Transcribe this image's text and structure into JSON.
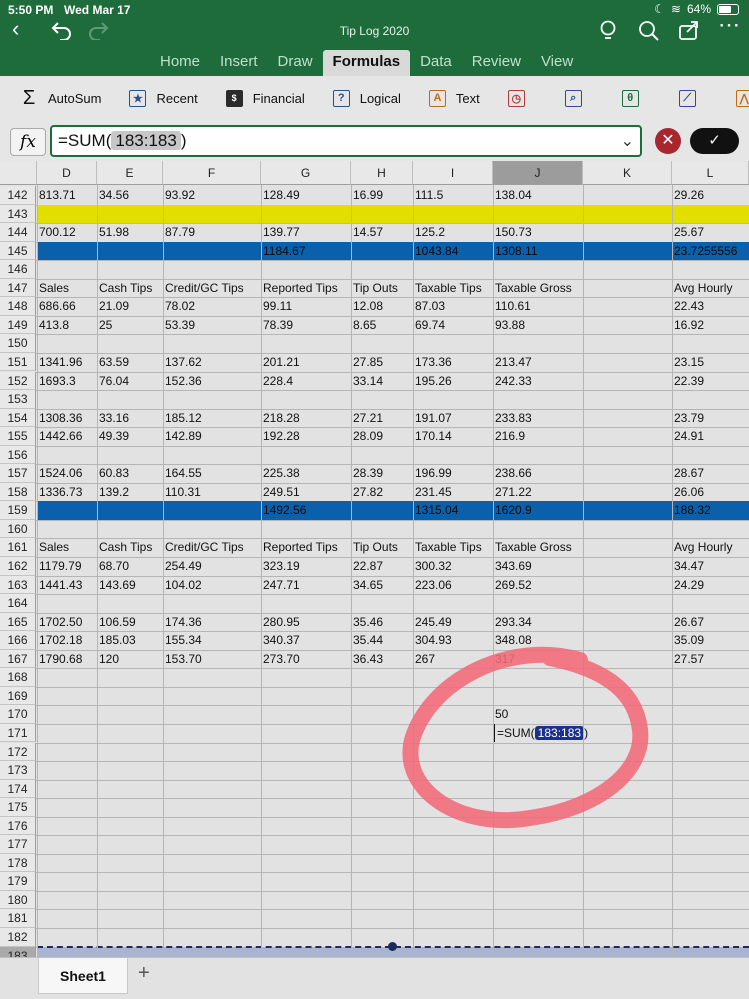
{
  "status": {
    "time": "5:50 PM",
    "date": "Wed Mar 17",
    "battery": "64%"
  },
  "doc_title": "Tip Log 2020",
  "icons": {
    "back": "chevron-left",
    "undo": "undo-arrow",
    "redo": "redo-arrow",
    "idea": "lightbulb",
    "search": "magnifier",
    "share": "share-box",
    "more": "ellipsis"
  },
  "ribbon_tabs": [
    "Home",
    "Insert",
    "Draw",
    "Formulas",
    "Data",
    "Review",
    "View"
  ],
  "active_tab": "Formulas",
  "toolbar": {
    "autosum": "AutoSum",
    "recent": "Recent",
    "financial": "Financial",
    "logical": "Logical",
    "text": "Text"
  },
  "formula_bar": {
    "fx": "fx",
    "prefix": "=SUM(",
    "ref": "183:183",
    "suffix": ")"
  },
  "columns": [
    "D",
    "E",
    "F",
    "G",
    "H",
    "I",
    "J",
    "K",
    "L"
  ],
  "selected_column": "J",
  "rows": [
    {
      "n": "142",
      "cells": [
        "813.71",
        "34.56",
        "93.92",
        "128.49",
        "16.99",
        "111.5",
        "138.04",
        "",
        "29.26"
      ]
    },
    {
      "n": "143",
      "band": "yellow",
      "cells": [
        "",
        "",
        "",
        "",
        "",
        "",
        "",
        "",
        ""
      ]
    },
    {
      "n": "144",
      "cells": [
        "700.12",
        "51.98",
        "87.79",
        "139.77",
        "14.57",
        "125.2",
        "150.73",
        "",
        "25.67"
      ]
    },
    {
      "n": "145",
      "band": "blue",
      "cells": [
        "",
        "",
        "",
        "1184.67",
        "",
        "1043.84",
        "1308.11",
        "",
        "23.7255556"
      ]
    },
    {
      "n": "146",
      "cells": [
        "",
        "",
        "",
        "",
        "",
        "",
        "",
        "",
        ""
      ]
    },
    {
      "n": "147",
      "cells": [
        "Sales",
        "Cash Tips",
        "Credit/GC Tips",
        "Reported Tips",
        "Tip Outs",
        "Taxable Tips",
        "Taxable Gross",
        "",
        "Avg Hourly"
      ]
    },
    {
      "n": "148",
      "cells": [
        "686.66",
        "21.09",
        "78.02",
        "99.11",
        "12.08",
        "87.03",
        "110.61",
        "",
        "22.43"
      ]
    },
    {
      "n": "149",
      "cells": [
        "413.8",
        "25",
        "53.39",
        "78.39",
        "8.65",
        "69.74",
        "93.88",
        "",
        "16.92"
      ]
    },
    {
      "n": "150",
      "cells": [
        "",
        "",
        "",
        "",
        "",
        "",
        "",
        "",
        ""
      ]
    },
    {
      "n": "151",
      "cells": [
        "1341.96",
        "63.59",
        "137.62",
        "201.21",
        "27.85",
        "173.36",
        "213.47",
        "",
        "23.15"
      ]
    },
    {
      "n": "152",
      "cells": [
        "1693.3",
        "76.04",
        "152.36",
        "228.4",
        "33.14",
        "195.26",
        "242.33",
        "",
        "22.39"
      ]
    },
    {
      "n": "153",
      "cells": [
        "",
        "",
        "",
        "",
        "",
        "",
        "",
        "",
        ""
      ]
    },
    {
      "n": "154",
      "cells": [
        "1308.36",
        "33.16",
        "185.12",
        "218.28",
        "27.21",
        "191.07",
        "233.83",
        "",
        "23.79"
      ]
    },
    {
      "n": "155",
      "cells": [
        "1442.66",
        "49.39",
        "142.89",
        "192.28",
        "28.09",
        "170.14",
        "216.9",
        "",
        "24.91"
      ]
    },
    {
      "n": "156",
      "cells": [
        "",
        "",
        "",
        "",
        "",
        "",
        "",
        "",
        ""
      ]
    },
    {
      "n": "157",
      "cells": [
        "1524.06",
        "60.83",
        "164.55",
        "225.38",
        "28.39",
        "196.99",
        "238.66",
        "",
        "28.67"
      ]
    },
    {
      "n": "158",
      "cells": [
        "1336.73",
        "139.2",
        "110.31",
        "249.51",
        "27.82",
        "231.45",
        "271.22",
        "",
        "26.06"
      ]
    },
    {
      "n": "159",
      "band": "blue",
      "cells": [
        "",
        "",
        "",
        "1492.56",
        "",
        "1315.04",
        "1620.9",
        "",
        "188.32"
      ]
    },
    {
      "n": "160",
      "cells": [
        "",
        "",
        "",
        "",
        "",
        "",
        "",
        "",
        ""
      ]
    },
    {
      "n": "161",
      "cells": [
        "Sales",
        "Cash Tips",
        "Credit/GC Tips",
        "Reported Tips",
        "Tip Outs",
        "Taxable Tips",
        "Taxable Gross",
        "",
        "Avg Hourly"
      ]
    },
    {
      "n": "162",
      "cells": [
        "1179.79",
        "68.70",
        "254.49",
        "323.19",
        "22.87",
        "300.32",
        "343.69",
        "",
        "34.47"
      ]
    },
    {
      "n": "163",
      "cells": [
        "1441.43",
        "143.69",
        "104.02",
        "247.71",
        "34.65",
        "223.06",
        "269.52",
        "",
        "24.29"
      ]
    },
    {
      "n": "164",
      "cells": [
        "",
        "",
        "",
        "",
        "",
        "",
        "",
        "",
        ""
      ]
    },
    {
      "n": "165",
      "cells": [
        "1702.50",
        "106.59",
        "174.36",
        "280.95",
        "35.46",
        "245.49",
        "293.34",
        "",
        "26.67"
      ]
    },
    {
      "n": "166",
      "cells": [
        "1702.18",
        "185.03",
        "155.34",
        "340.37",
        "35.44",
        "304.93",
        "348.08",
        "",
        "35.09"
      ]
    },
    {
      "n": "167",
      "cells": [
        "1790.68",
        "120",
        "153.70",
        "273.70",
        "36.43",
        "267",
        "317",
        "",
        "27.57"
      ]
    },
    {
      "n": "168",
      "cells": [
        "",
        "",
        "",
        "",
        "",
        "",
        "",
        "",
        ""
      ]
    },
    {
      "n": "169",
      "cells": [
        "",
        "",
        "",
        "",
        "",
        "",
        "",
        "",
        ""
      ]
    },
    {
      "n": "170",
      "cells": [
        "",
        "",
        "",
        "",
        "",
        "",
        "50",
        "",
        ""
      ]
    },
    {
      "n": "171",
      "active": true,
      "cells": [
        "",
        "",
        "",
        "",
        "",
        "",
        "",
        "",
        ""
      ]
    },
    {
      "n": "172",
      "cells": [
        "",
        "",
        "",
        "",
        "",
        "",
        "",
        "",
        ""
      ]
    },
    {
      "n": "173",
      "cells": [
        "",
        "",
        "",
        "",
        "",
        "",
        "",
        "",
        ""
      ]
    },
    {
      "n": "174",
      "cells": [
        "",
        "",
        "",
        "",
        "",
        "",
        "",
        "",
        ""
      ]
    },
    {
      "n": "175",
      "cells": [
        "",
        "",
        "",
        "",
        "",
        "",
        "",
        "",
        ""
      ]
    },
    {
      "n": "176",
      "cells": [
        "",
        "",
        "",
        "",
        "",
        "",
        "",
        "",
        ""
      ]
    },
    {
      "n": "177",
      "cells": [
        "",
        "",
        "",
        "",
        "",
        "",
        "",
        "",
        ""
      ]
    },
    {
      "n": "178",
      "cells": [
        "",
        "",
        "",
        "",
        "",
        "",
        "",
        "",
        ""
      ]
    },
    {
      "n": "179",
      "cells": [
        "",
        "",
        "",
        "",
        "",
        "",
        "",
        "",
        ""
      ]
    },
    {
      "n": "180",
      "cells": [
        "",
        "",
        "",
        "",
        "",
        "",
        "",
        "",
        ""
      ]
    },
    {
      "n": "181",
      "cells": [
        "",
        "",
        "",
        "",
        "",
        "",
        "",
        "",
        ""
      ]
    },
    {
      "n": "182",
      "cells": [
        "",
        "",
        "",
        "",
        "",
        "",
        "",
        "",
        ""
      ]
    },
    {
      "n": "183",
      "band": "sel",
      "cells": [
        "",
        "",
        "",
        "",
        "",
        "",
        "",
        "",
        ""
      ]
    }
  ],
  "active_cell": {
    "prefix": "=SUM(",
    "ref": "183:183",
    "suffix": ")"
  },
  "sheet_tab": "Sheet1",
  "colors": {
    "chrome": "#1e6b3c",
    "yellow_band": "#e1de00",
    "blue_band": "#0b60ac",
    "selected_row": "#a9b5d0",
    "annotation": "#f26a78"
  }
}
